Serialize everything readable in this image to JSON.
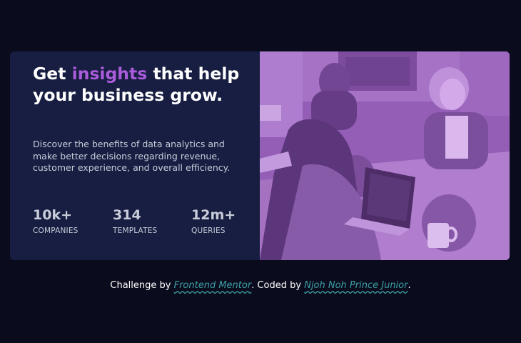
{
  "card": {
    "title_before": "Get ",
    "title_accent": "insights",
    "title_after": " that help your business grow.",
    "description": "Discover the benefits of data analytics and make better decisions regarding revenue, customer experience, and overall efficiency.",
    "stats": [
      {
        "value": "10k+",
        "label": "COMPANIES"
      },
      {
        "value": "314",
        "label": "TEMPLATES"
      },
      {
        "value": "12m+",
        "label": "QUERIES"
      }
    ]
  },
  "footer": {
    "prefix": "Challenge by ",
    "link1": "Frontend Mentor",
    "middle": ". Coded by ",
    "link2": "Njoh Noh Prince Junior",
    "suffix": "."
  },
  "colors": {
    "page_bg": "#0a0c1d",
    "card_bg": "#171e42",
    "accent": "#aa5cdb",
    "photo_overlay": "#aa5cdb",
    "link": "#3e9ea5"
  }
}
